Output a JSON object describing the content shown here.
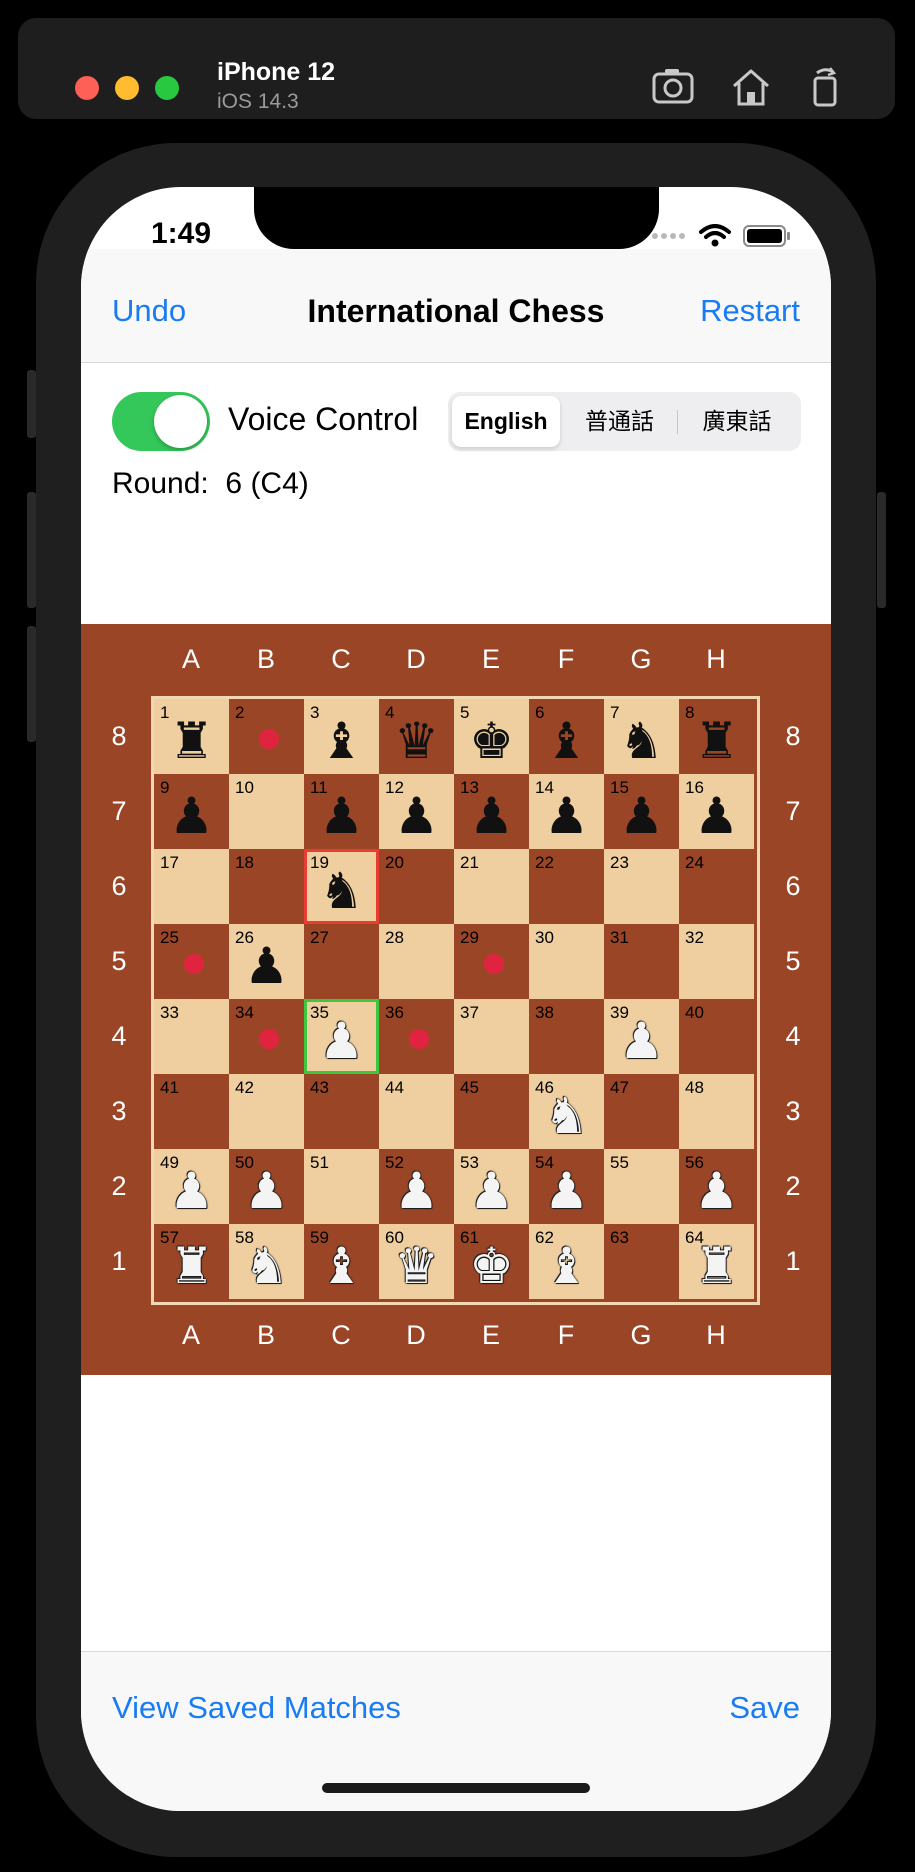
{
  "simulator": {
    "device_name": "iPhone 12",
    "os_version": "iOS 14.3",
    "icons": [
      "screenshot-icon",
      "home-icon",
      "rotate-icon"
    ]
  },
  "status_bar": {
    "time": "1:49"
  },
  "navbar": {
    "left_button": "Undo",
    "title": "International Chess",
    "right_button": "Restart"
  },
  "controls": {
    "voice_control_label": "Voice Control",
    "voice_control_on": true,
    "languages": [
      "English",
      "普通話",
      "廣東話"
    ],
    "selected_language": "English",
    "round_label": "Round:",
    "round_value": "6 (C4)"
  },
  "board": {
    "columns": [
      "A",
      "B",
      "C",
      "D",
      "E",
      "F",
      "G",
      "H"
    ],
    "rows": [
      "8",
      "7",
      "6",
      "5",
      "4",
      "3",
      "2",
      "1"
    ],
    "squares": [
      {
        "n": "1",
        "piece": "rook",
        "color": "black"
      },
      {
        "n": "2",
        "dot": true
      },
      {
        "n": "3",
        "piece": "bishop",
        "color": "black"
      },
      {
        "n": "4",
        "piece": "queen",
        "color": "black"
      },
      {
        "n": "5",
        "piece": "king",
        "color": "black"
      },
      {
        "n": "6",
        "piece": "bishop",
        "color": "black"
      },
      {
        "n": "7",
        "piece": "knight",
        "color": "black"
      },
      {
        "n": "8",
        "piece": "rook",
        "color": "black"
      },
      {
        "n": "9",
        "piece": "pawn",
        "color": "black"
      },
      {
        "n": "10"
      },
      {
        "n": "11",
        "piece": "pawn",
        "color": "black"
      },
      {
        "n": "12",
        "piece": "pawn",
        "color": "black"
      },
      {
        "n": "13",
        "piece": "pawn",
        "color": "black"
      },
      {
        "n": "14",
        "piece": "pawn",
        "color": "black"
      },
      {
        "n": "15",
        "piece": "pawn",
        "color": "black"
      },
      {
        "n": "16",
        "piece": "pawn",
        "color": "black"
      },
      {
        "n": "17"
      },
      {
        "n": "18"
      },
      {
        "n": "19",
        "piece": "knight",
        "color": "black",
        "selected": true
      },
      {
        "n": "20"
      },
      {
        "n": "21"
      },
      {
        "n": "22"
      },
      {
        "n": "23"
      },
      {
        "n": "24"
      },
      {
        "n": "25",
        "dot": true
      },
      {
        "n": "26",
        "piece": "pawn",
        "color": "black"
      },
      {
        "n": "27"
      },
      {
        "n": "28"
      },
      {
        "n": "29",
        "dot": true
      },
      {
        "n": "30"
      },
      {
        "n": "31"
      },
      {
        "n": "32"
      },
      {
        "n": "33"
      },
      {
        "n": "34",
        "dot": true
      },
      {
        "n": "35",
        "piece": "pawn",
        "color": "white",
        "last_move": true
      },
      {
        "n": "36",
        "dot": true
      },
      {
        "n": "37"
      },
      {
        "n": "38"
      },
      {
        "n": "39",
        "piece": "pawn",
        "color": "white"
      },
      {
        "n": "40"
      },
      {
        "n": "41"
      },
      {
        "n": "42"
      },
      {
        "n": "43"
      },
      {
        "n": "44"
      },
      {
        "n": "45"
      },
      {
        "n": "46",
        "piece": "knight",
        "color": "white"
      },
      {
        "n": "47"
      },
      {
        "n": "48"
      },
      {
        "n": "49",
        "piece": "pawn",
        "color": "white"
      },
      {
        "n": "50",
        "piece": "pawn",
        "color": "white"
      },
      {
        "n": "51"
      },
      {
        "n": "52",
        "piece": "pawn",
        "color": "white"
      },
      {
        "n": "53",
        "piece": "pawn",
        "color": "white"
      },
      {
        "n": "54",
        "piece": "pawn",
        "color": "white"
      },
      {
        "n": "55"
      },
      {
        "n": "56",
        "piece": "pawn",
        "color": "white"
      },
      {
        "n": "57",
        "piece": "rook",
        "color": "white"
      },
      {
        "n": "58",
        "piece": "knight",
        "color": "white"
      },
      {
        "n": "59",
        "piece": "bishop",
        "color": "white"
      },
      {
        "n": "60",
        "piece": "queen",
        "color": "white"
      },
      {
        "n": "61",
        "piece": "king",
        "color": "white"
      },
      {
        "n": "62",
        "piece": "bishop",
        "color": "white"
      },
      {
        "n": "63"
      },
      {
        "n": "64",
        "piece": "rook",
        "color": "white"
      }
    ]
  },
  "toolbar": {
    "left_button": "View Saved Matches",
    "right_button": "Save"
  },
  "colors": {
    "accent": "#1a7cf2",
    "toggle_on": "#34c759",
    "board_dark": "#9b4527",
    "board_light": "#efcfa0",
    "move_dot": "#e0243f",
    "selected_border": "#e83d33",
    "last_move_border": "#3cc73c"
  }
}
